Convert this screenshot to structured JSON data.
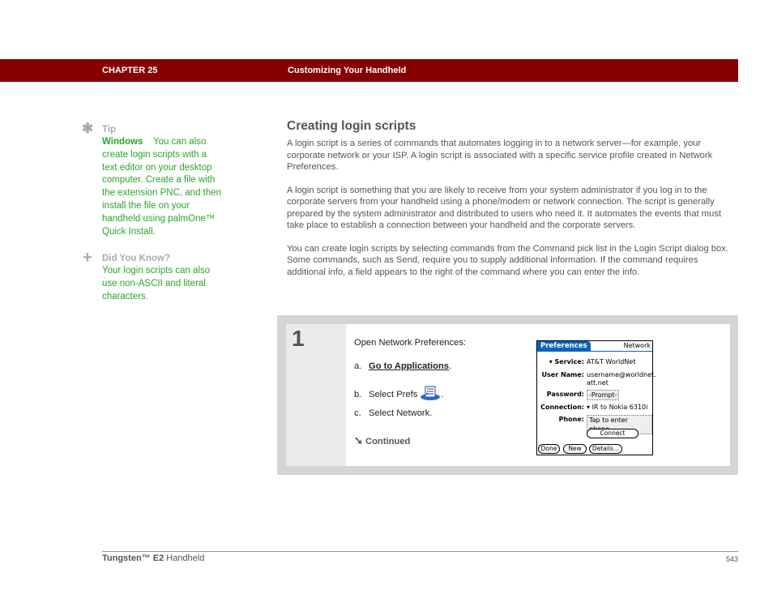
{
  "header": {
    "chapter": "CHAPTER 25",
    "title": "Customizing Your Handheld",
    "bar_color": "#870000"
  },
  "sidebar": {
    "tip": {
      "icon": "asterisk-icon",
      "heading": "Tip",
      "lead": "Windows",
      "text": "You can also create login scripts with a text editor on your desktop computer. Create a file with the extension PNC, and then install the file on your handheld using palmOne™ Quick Install."
    },
    "did_you_know": {
      "icon": "plus-icon",
      "heading": "Did You Know?",
      "text": "Your login scripts can also use non-ASCII and literal characters."
    }
  },
  "main": {
    "title": "Creating login scripts",
    "paragraphs": [
      "A login script is a series of commands that automates logging in to a network server—for example, your corporate network or your ISP. A login script is associated with a specific service profile created in Network Preferences.",
      "A login script is something that you are likely to receive from your system administrator if you log in to the corporate servers from your handheld using a phone/modem or network connection. The script is generally prepared by the system administrator and distributed to users who need it. It automates the events that must take place to establish a connection between your handheld and the corporate servers.",
      "You can create login scripts by selecting commands from the Command pick list in the Login Script dialog box. Some commands, such as Send, require you to supply additional information. If the command requires additional info, a field appears to the right of the command where you can enter the info."
    ]
  },
  "step": {
    "number": "1",
    "intro": "Open Network Preferences:",
    "items": [
      {
        "label": "a.",
        "link": "Go to Applications",
        "suffix": "."
      },
      {
        "label": "b.",
        "text": "Select Prefs",
        "icon": "prefs-icon",
        "suffix": "."
      },
      {
        "label": "c.",
        "text": "Select Network."
      }
    ],
    "continued": "Continued",
    "continued_icon": "arrow-down-right-icon"
  },
  "palm_screen": {
    "tab": "Preferences",
    "app": "Network",
    "fields": {
      "service_label": "Service:",
      "service_value": "AT&T WorldNet",
      "username_label": "User Name:",
      "username_value_1": "username@worldnet.",
      "username_value_2": "att.net",
      "password_label": "Password:",
      "password_value": "-Prompt-",
      "connection_label": "Connection:",
      "connection_value": "IR to Nokia 6310i",
      "phone_label": "Phone:",
      "phone_value": "Tap to enter phone"
    },
    "buttons": {
      "connect": "Connect",
      "done": "Done",
      "new": "New",
      "details": "Details..."
    }
  },
  "footer": {
    "product_bold": "Tungsten™ E2",
    "product_rest": " Handheld",
    "page": "543"
  }
}
